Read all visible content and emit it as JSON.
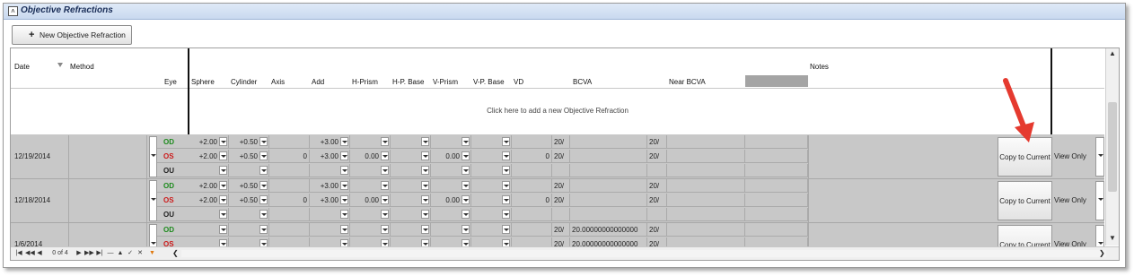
{
  "panel": {
    "title": "Objective Refractions",
    "collapse_icon": "collapse-up-icon"
  },
  "toolbar": {
    "new_label": "New Objective Refraction",
    "new_icon": "plus-icon"
  },
  "grid": {
    "columns": {
      "date": "Date",
      "method": "Method",
      "eye": "Eye",
      "sphere": "Sphere",
      "cylinder": "Cylinder",
      "axis": "Axis",
      "add": "Add",
      "h_prism": "H-Prism",
      "h_base": "H-P. Base",
      "v_prism": "V-Prism",
      "v_base": "V-P. Base",
      "vd": "VD",
      "bcva": "BCVA",
      "near_bcva": "Near BCVA",
      "notes": "Notes"
    },
    "add_row_text": "Click here to add a new Objective Refraction",
    "records": [
      {
        "date": "12/19/2014",
        "copy_label": "Copy to Current",
        "view_label": "View Only",
        "rows": [
          {
            "eye": "OD",
            "sphere": "+2.00",
            "cylinder": "+0.50",
            "axis": "",
            "add": "+3.00",
            "h_prism": "",
            "v_prism": "",
            "vd": "",
            "bcva_prefix": "20/",
            "bcva": "",
            "near_prefix": "20/"
          },
          {
            "eye": "OS",
            "sphere": "+2.00",
            "cylinder": "+0.50",
            "axis": "0",
            "add": "+3.00",
            "h_prism": "0.00",
            "v_prism": "0.00",
            "vd": "0",
            "bcva_prefix": "20/",
            "bcva": "",
            "near_prefix": "20/"
          },
          {
            "eye": "OU",
            "sphere": "",
            "cylinder": "",
            "axis": "",
            "add": "",
            "h_prism": "",
            "v_prism": "",
            "vd": "",
            "bcva_prefix": "",
            "bcva": "",
            "near_prefix": ""
          }
        ]
      },
      {
        "date": "12/18/2014",
        "copy_label": "Copy to Current",
        "view_label": "View Only",
        "rows": [
          {
            "eye": "OD",
            "sphere": "+2.00",
            "cylinder": "+0.50",
            "axis": "",
            "add": "+3.00",
            "h_prism": "",
            "v_prism": "",
            "vd": "",
            "bcva_prefix": "20/",
            "bcva": "",
            "near_prefix": "20/"
          },
          {
            "eye": "OS",
            "sphere": "+2.00",
            "cylinder": "+0.50",
            "axis": "0",
            "add": "+3.00",
            "h_prism": "0.00",
            "v_prism": "0.00",
            "vd": "0",
            "bcva_prefix": "20/",
            "bcva": "",
            "near_prefix": "20/"
          },
          {
            "eye": "OU",
            "sphere": "",
            "cylinder": "",
            "axis": "",
            "add": "",
            "h_prism": "",
            "v_prism": "",
            "vd": "",
            "bcva_prefix": "",
            "bcva": "",
            "near_prefix": ""
          }
        ]
      },
      {
        "date": "1/6/2014",
        "copy_label": "Copy to Current",
        "view_label": "View Only",
        "rows": [
          {
            "eye": "OD",
            "sphere": "",
            "cylinder": "",
            "axis": "",
            "add": "",
            "h_prism": "",
            "v_prism": "",
            "vd": "",
            "bcva_prefix": "20/",
            "bcva": "20.00000000000000",
            "near_prefix": "20/"
          },
          {
            "eye": "OS",
            "sphere": "",
            "cylinder": "",
            "axis": "",
            "add": "",
            "h_prism": "",
            "v_prism": "",
            "vd": "",
            "bcva_prefix": "20/",
            "bcva": "20.00000000000000",
            "near_prefix": "20/"
          },
          {
            "eye": "OU",
            "sphere": "",
            "cylinder": "",
            "axis": "",
            "add": "",
            "h_prism": "",
            "v_prism": "",
            "vd": "",
            "bcva_prefix": "",
            "bcva": "",
            "near_prefix": ""
          }
        ]
      }
    ]
  },
  "pager": {
    "page_text": "0 of 4"
  },
  "annotation": {
    "arrow_color": "#e53a2f"
  }
}
